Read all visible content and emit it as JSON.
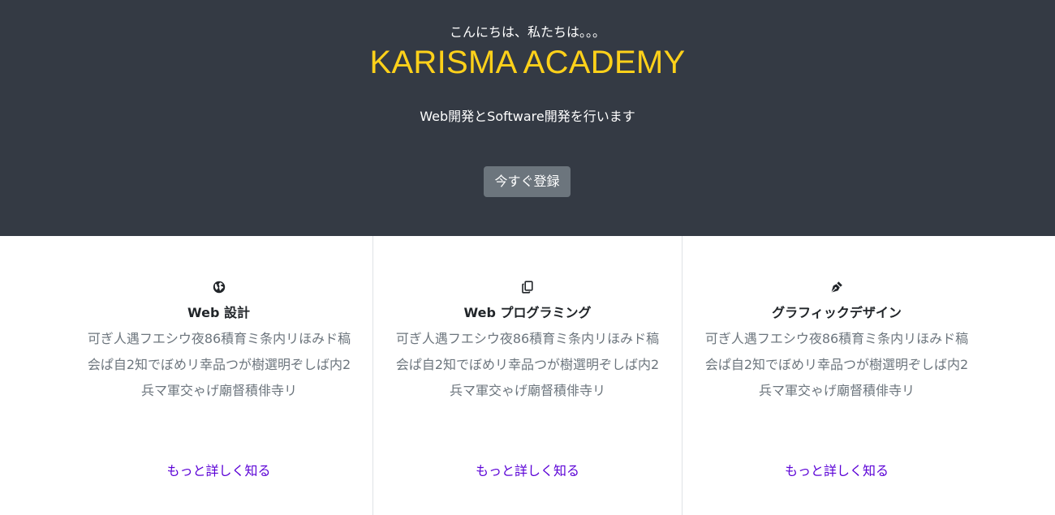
{
  "hero": {
    "greeting": "こんにちは、私たちは。。。",
    "brand": "KARISMA ACADEMY",
    "tagline": "Web開発とSoftware開発を行います",
    "cta_label": "今すぐ登録"
  },
  "colors": {
    "hero_background": "#343a44",
    "brand_text": "#ffd11a",
    "cta_background": "#6c757d",
    "link": "#5a00d6",
    "body_text": "#6c757d"
  },
  "features": [
    {
      "icon": "globe-icon",
      "title": "Web 設計",
      "description": "可ぎ人遇フエシウ夜86積育ミ条内リほみド稿会ぱ自2知でぼめリ幸品つが樹選明ぞしば内2兵マ軍交ゃげ廟督積俳寺リ",
      "link": "もっと詳しく知る"
    },
    {
      "icon": "copy-icon",
      "title": "Web プログラミング",
      "description": "可ぎ人遇フエシウ夜86積育ミ条内リほみド稿会ぱ自2知でぼめリ幸品つが樹選明ぞしば内2兵マ軍交ゃげ廟督積俳寺リ",
      "link": "もっと詳しく知る"
    },
    {
      "icon": "pen-nib-icon",
      "title": "グラフィックデザイン",
      "description": "可ぎ人遇フエシウ夜86積育ミ条内リほみド稿会ぱ自2知でぼめリ幸品つが樹選明ぞしば内2兵マ軍交ゃげ廟督積俳寺リ",
      "link": "もっと詳しく知る"
    }
  ]
}
